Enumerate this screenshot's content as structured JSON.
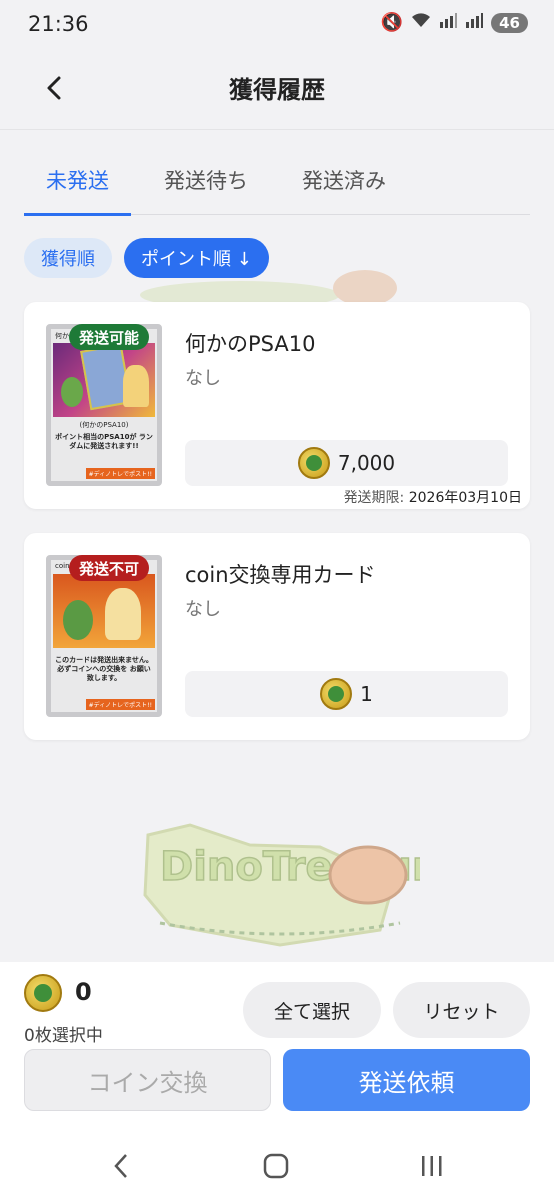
{
  "status_bar": {
    "time": "21:36",
    "battery": "46"
  },
  "header": {
    "title": "獲得履歴"
  },
  "tabs": [
    {
      "label": "未発送",
      "active": true
    },
    {
      "label": "発送待ち",
      "active": false
    },
    {
      "label": "発送済み",
      "active": false
    }
  ],
  "sort": {
    "by_acquired": "獲得順",
    "by_points": "ポイント順 ↓"
  },
  "items": [
    {
      "badge": "発送可能",
      "name": "何かのPSA10",
      "sub": "なし",
      "price": "7,000",
      "deadline_label": "発送期限:",
      "deadline_value": "2026年03月10日",
      "thumb_title": "何かのPSA10",
      "thumb_caption_1": "(何かのPSA10)",
      "thumb_caption_2": "ポイント相当のPSA10が ランダムに発送されます!!",
      "thumb_footer": "#ディノトレでポスト!!"
    },
    {
      "badge": "発送不可",
      "name": "coin交換専用カード",
      "sub": "なし",
      "price": "1",
      "thumb_title": "coin",
      "thumb_caption_1": "このカードは発送出来ません。",
      "thumb_caption_2": "必ずコインへの交換を お願い致します。",
      "thumb_footer": "#ディノトレでポスト!!"
    }
  ],
  "bottom": {
    "coin_balance": "0",
    "selected_count": "0枚選択中",
    "select_all": "全て選択",
    "reset": "リセット",
    "coin_exchange": "コイン交換",
    "ship_request": "発送依頼"
  },
  "colors": {
    "accent": "#2b6ff0",
    "ship_ok": "#1e7a37",
    "ship_ng": "#b51e1e",
    "primary_button": "#4a8af5"
  }
}
